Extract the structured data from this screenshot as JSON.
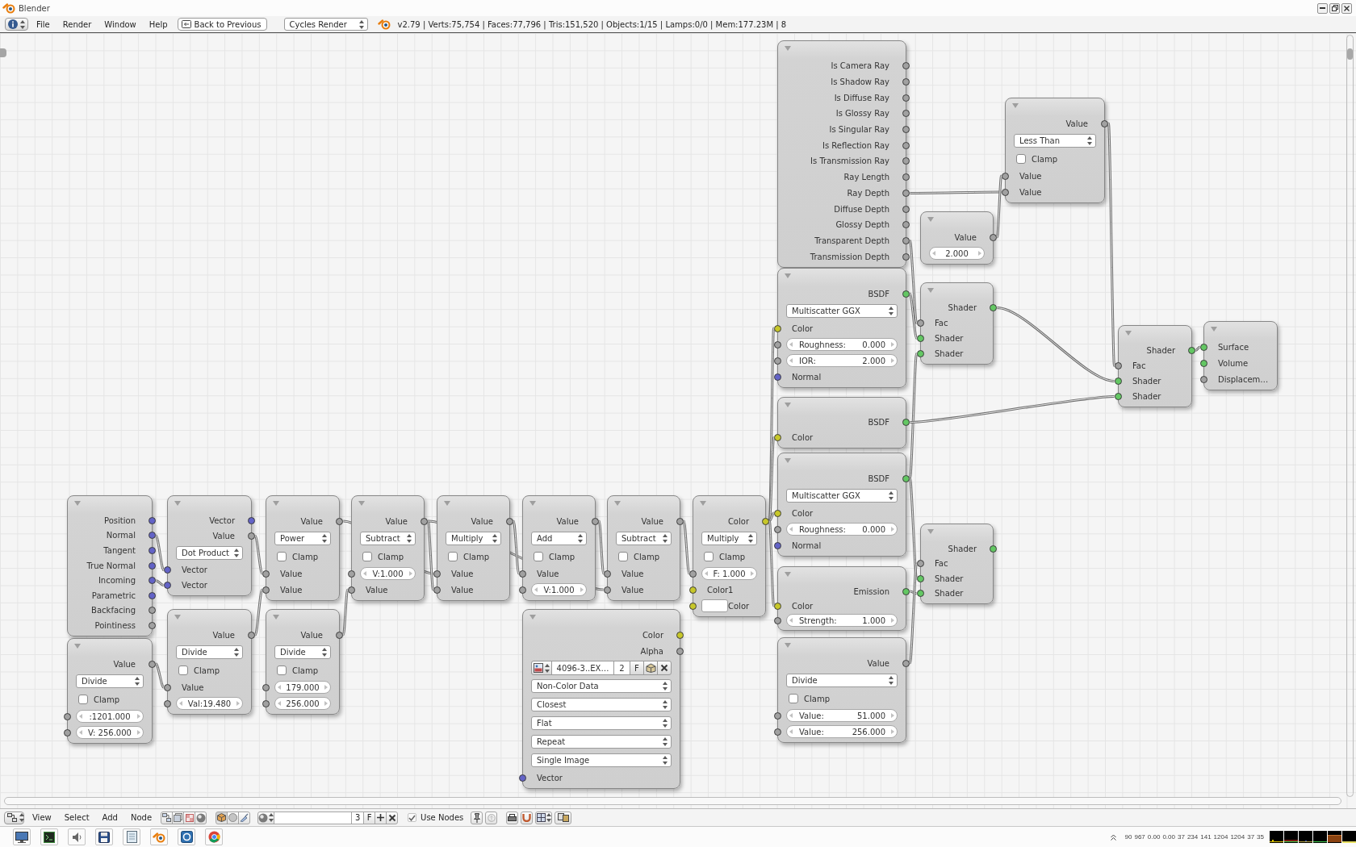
{
  "window": {
    "title": "Blender"
  },
  "menu_bar": {
    "menus": [
      "File",
      "Render",
      "Window",
      "Help"
    ],
    "back_button": "Back to Previous",
    "render_engine": "Cycles Render",
    "stats": "v2.79 | Verts:75,754 | Faces:77,796 | Tris:151,520 | Objects:1/15 | Lamps:0/0 | Mem:177.23M | 8"
  },
  "node_editor": {
    "nodes": [
      {
        "rows": [
          {
            "kind": "output",
            "label": "Position",
            "color": "#6363c7"
          },
          {
            "kind": "output",
            "label": "Normal",
            "color": "#6363c7"
          },
          {
            "kind": "output",
            "label": "Tangent",
            "color": "#6363c7"
          },
          {
            "kind": "output",
            "label": "True Normal",
            "color": "#6363c7"
          },
          {
            "kind": "output",
            "label": "Incoming",
            "color": "#6363c7"
          },
          {
            "kind": "output",
            "label": "Parametric",
            "color": "#6363c7"
          },
          {
            "kind": "output",
            "label": "Backfacing",
            "color": "#a1a1a1"
          },
          {
            "kind": "output",
            "label": "Pointiness",
            "color": "#a1a1a1"
          }
        ]
      },
      {
        "rows": [
          {
            "kind": "output",
            "label": "Value",
            "color": "#a1a1a1"
          },
          {
            "kind": "dropdown",
            "value": "Divide"
          },
          {
            "kind": "checkbox",
            "label": "Clamp",
            "checked": false
          },
          {
            "kind": "field",
            "value": ":1201.000",
            "color": "#a1a1a1"
          },
          {
            "kind": "field",
            "value": "V: 256.000",
            "color": "#a1a1a1"
          }
        ]
      },
      {
        "rows": [
          {
            "kind": "output",
            "label": "Vector",
            "color": "#6363c7"
          },
          {
            "kind": "output",
            "label": "Value",
            "color": "#a1a1a1"
          },
          {
            "kind": "dropdown",
            "value": "Dot Product"
          },
          {
            "kind": "input",
            "label": "Vector",
            "color": "#6363c7"
          },
          {
            "kind": "input",
            "label": "Vector",
            "color": "#6363c7"
          }
        ]
      },
      {
        "rows": [
          {
            "kind": "output",
            "label": "Value",
            "color": "#a1a1a1"
          },
          {
            "kind": "dropdown",
            "value": "Divide"
          },
          {
            "kind": "checkbox",
            "label": "Clamp",
            "checked": false
          },
          {
            "kind": "input",
            "label": "Value",
            "color": "#a1a1a1"
          },
          {
            "kind": "field",
            "value": "Val:19.480",
            "color": "#a1a1a1"
          }
        ]
      },
      {
        "rows": [
          {
            "kind": "output",
            "label": "Value",
            "color": "#a1a1a1"
          },
          {
            "kind": "dropdown",
            "value": "Power"
          },
          {
            "kind": "checkbox",
            "label": "Clamp",
            "checked": false
          },
          {
            "kind": "input",
            "label": "Value",
            "color": "#a1a1a1"
          },
          {
            "kind": "input",
            "label": "Value",
            "color": "#a1a1a1"
          }
        ]
      },
      {
        "rows": [
          {
            "kind": "output",
            "label": "Value",
            "color": "#a1a1a1"
          },
          {
            "kind": "dropdown",
            "value": "Divide"
          },
          {
            "kind": "checkbox",
            "label": "Clamp",
            "checked": false
          },
          {
            "kind": "field",
            "value": "179.000",
            "color": "#a1a1a1"
          },
          {
            "kind": "field",
            "value": "256.000",
            "color": "#a1a1a1"
          }
        ]
      },
      {
        "rows": [
          {
            "kind": "output",
            "label": "Value",
            "color": "#a1a1a1"
          },
          {
            "kind": "dropdown",
            "value": "Subtract"
          },
          {
            "kind": "checkbox",
            "label": "Clamp",
            "checked": false
          },
          {
            "kind": "field",
            "value": "V:1.000",
            "color": "#a1a1a1"
          },
          {
            "kind": "input",
            "label": "Value",
            "color": "#a1a1a1"
          }
        ]
      },
      {
        "rows": [
          {
            "kind": "output",
            "label": "Value",
            "color": "#a1a1a1"
          },
          {
            "kind": "dropdown",
            "value": "Multiply"
          },
          {
            "kind": "checkbox",
            "label": "Clamp",
            "checked": false
          },
          {
            "kind": "input",
            "label": "Value",
            "color": "#a1a1a1"
          },
          {
            "kind": "input",
            "label": "Value",
            "color": "#a1a1a1"
          }
        ]
      },
      {
        "rows": [
          {
            "kind": "output",
            "label": "Value",
            "color": "#a1a1a1"
          },
          {
            "kind": "dropdown",
            "value": "Add"
          },
          {
            "kind": "checkbox",
            "label": "Clamp",
            "checked": false
          },
          {
            "kind": "input",
            "label": "Value",
            "color": "#a1a1a1"
          },
          {
            "kind": "field",
            "value": "V:1.000",
            "color": "#a1a1a1"
          }
        ]
      },
      {
        "rows": [
          {
            "kind": "output",
            "label": "Value",
            "color": "#a1a1a1"
          },
          {
            "kind": "dropdown",
            "value": "Subtract"
          },
          {
            "kind": "checkbox",
            "label": "Clamp",
            "checked": false
          },
          {
            "kind": "input",
            "label": "Value",
            "color": "#a1a1a1"
          },
          {
            "kind": "input",
            "label": "Value",
            "color": "#a1a1a1"
          }
        ]
      },
      {
        "rows": [
          {
            "kind": "output",
            "label": "Color",
            "color": "#c7c729"
          },
          {
            "kind": "dropdown",
            "value": "Multiply"
          },
          {
            "kind": "checkbox",
            "label": "Clamp",
            "checked": false
          },
          {
            "kind": "field",
            "value": "F: 1.000",
            "color": "#a1a1a1"
          },
          {
            "kind": "input",
            "label": "Color1",
            "color": "#c7c729"
          },
          {
            "kind": "swatch",
            "label": "Color",
            "color": "#c7c729"
          }
        ]
      },
      {
        "rows": [
          {
            "kind": "output",
            "label": "Color",
            "color": "#c7c729"
          },
          {
            "kind": "output",
            "label": "Alpha",
            "color": "#a1a1a1"
          },
          {
            "kind": "image",
            "name": "4096-3..EX…",
            "users": "2",
            "fake_user": "F"
          },
          {
            "kind": "dropdown",
            "value": "Non-Color Data"
          },
          {
            "kind": "dropdown",
            "value": "Closest"
          },
          {
            "kind": "dropdown",
            "value": "Flat"
          },
          {
            "kind": "dropdown",
            "value": "Repeat"
          },
          {
            "kind": "dropdown",
            "value": "Single Image"
          },
          {
            "kind": "input",
            "label": "Vector",
            "color": "#6363c7"
          }
        ]
      },
      {
        "rows": [
          {
            "kind": "output",
            "label": "Is Camera Ray",
            "color": "#a1a1a1"
          },
          {
            "kind": "output",
            "label": "Is Shadow Ray",
            "color": "#a1a1a1"
          },
          {
            "kind": "output",
            "label": "Is Diffuse Ray",
            "color": "#a1a1a1"
          },
          {
            "kind": "output",
            "label": "Is Glossy Ray",
            "color": "#a1a1a1"
          },
          {
            "kind": "output",
            "label": "Is Singular Ray",
            "color": "#a1a1a1"
          },
          {
            "kind": "output",
            "label": "Is Reflection Ray",
            "color": "#a1a1a1"
          },
          {
            "kind": "output",
            "label": "Is Transmission Ray",
            "color": "#a1a1a1"
          },
          {
            "kind": "output",
            "label": "Ray Length",
            "color": "#a1a1a1"
          },
          {
            "kind": "output",
            "label": "Ray Depth",
            "color": "#a1a1a1"
          },
          {
            "kind": "output",
            "label": "Diffuse Depth",
            "color": "#a1a1a1"
          },
          {
            "kind": "output",
            "label": "Glossy Depth",
            "color": "#a1a1a1"
          },
          {
            "kind": "output",
            "label": "Transparent Depth",
            "color": "#a1a1a1"
          },
          {
            "kind": "output",
            "label": "Transmission Depth",
            "color": "#a1a1a1"
          }
        ]
      },
      {
        "rows": [
          {
            "kind": "output",
            "label": "BSDF",
            "color": "#63c763"
          },
          {
            "kind": "dropdown",
            "value": "Multiscatter GGX"
          },
          {
            "kind": "input",
            "label": "Color",
            "color": "#c7c729"
          },
          {
            "kind": "field",
            "label": "Roughness:",
            "value": "0.000",
            "color": "#a1a1a1"
          },
          {
            "kind": "field",
            "label": "IOR:",
            "value": "2.000",
            "color": "#a1a1a1"
          },
          {
            "kind": "input",
            "label": "Normal",
            "color": "#6363c7"
          }
        ]
      },
      {
        "rows": [
          {
            "kind": "output",
            "label": "BSDF",
            "color": "#63c763"
          },
          {
            "kind": "input",
            "label": "Color",
            "color": "#c7c729"
          }
        ]
      },
      {
        "rows": [
          {
            "kind": "output",
            "label": "BSDF",
            "color": "#63c763"
          },
          {
            "kind": "dropdown",
            "value": "Multiscatter GGX"
          },
          {
            "kind": "input",
            "label": "Color",
            "color": "#c7c729"
          },
          {
            "kind": "field",
            "label": "Roughness:",
            "value": "0.000",
            "color": "#a1a1a1"
          },
          {
            "kind": "input",
            "label": "Normal",
            "color": "#6363c7"
          }
        ]
      },
      {
        "rows": [
          {
            "kind": "output",
            "label": "Emission",
            "color": "#63c763"
          },
          {
            "kind": "input",
            "label": "Color",
            "color": "#c7c729"
          },
          {
            "kind": "field",
            "label": "Strength:",
            "value": "1.000",
            "color": "#a1a1a1"
          }
        ]
      },
      {
        "rows": [
          {
            "kind": "output",
            "label": "Value",
            "color": "#a1a1a1"
          },
          {
            "kind": "dropdown",
            "value": "Divide"
          },
          {
            "kind": "checkbox",
            "label": "Clamp",
            "checked": false
          },
          {
            "kind": "field",
            "label": "Value:",
            "value": "51.000",
            "color": "#a1a1a1"
          },
          {
            "kind": "field",
            "label": "Value:",
            "value": "256.000",
            "color": "#a1a1a1"
          }
        ]
      },
      {
        "rows": [
          {
            "kind": "output",
            "label": "Value",
            "color": "#a1a1a1"
          },
          {
            "kind": "field",
            "value": "2.000"
          }
        ]
      },
      {
        "rows": [
          {
            "kind": "output",
            "label": "Value",
            "color": "#a1a1a1"
          },
          {
            "kind": "dropdown",
            "value": "Less Than"
          },
          {
            "kind": "checkbox",
            "label": "Clamp",
            "checked": false
          },
          {
            "kind": "input",
            "label": "Value",
            "color": "#a1a1a1"
          },
          {
            "kind": "input",
            "label": "Value",
            "color": "#a1a1a1"
          }
        ]
      },
      {
        "rows": [
          {
            "kind": "output",
            "label": "Shader",
            "color": "#63c763"
          },
          {
            "kind": "input",
            "label": "Fac",
            "color": "#a1a1a1"
          },
          {
            "kind": "input",
            "label": "Shader",
            "color": "#63c763"
          },
          {
            "kind": "input",
            "label": "Shader",
            "color": "#63c763"
          }
        ]
      },
      {
        "rows": [
          {
            "kind": "output",
            "label": "Shader",
            "color": "#63c763"
          },
          {
            "kind": "input",
            "label": "Fac",
            "color": "#a1a1a1"
          },
          {
            "kind": "input",
            "label": "Shader",
            "color": "#63c763"
          },
          {
            "kind": "input",
            "label": "Shader",
            "color": "#63c763"
          }
        ]
      },
      {
        "rows": [
          {
            "kind": "output",
            "label": "Shader",
            "color": "#63c763"
          },
          {
            "kind": "input",
            "label": "Fac",
            "color": "#a1a1a1"
          },
          {
            "kind": "input",
            "label": "Shader",
            "color": "#63c763"
          },
          {
            "kind": "input",
            "label": "Shader",
            "color": "#63c763"
          }
        ]
      },
      {
        "rows": [
          {
            "kind": "input",
            "label": "Surface",
            "color": "#63c763"
          },
          {
            "kind": "input",
            "label": "Volume",
            "color": "#63c763"
          },
          {
            "kind": "input",
            "label": "Displacem…",
            "color": "#a1a1a1"
          }
        ]
      }
    ]
  },
  "editor_header": {
    "menus": [
      "View",
      "Select",
      "Add",
      "Node"
    ],
    "users": "3",
    "fake_user": "F",
    "use_nodes": {
      "label": "Use Nodes",
      "checked": true
    }
  },
  "taskbar": {
    "tray_readings": [
      "90",
      "967",
      "0.00",
      "0.00",
      "37",
      "234",
      "141",
      "1204",
      "1204",
      "37",
      "35"
    ]
  }
}
